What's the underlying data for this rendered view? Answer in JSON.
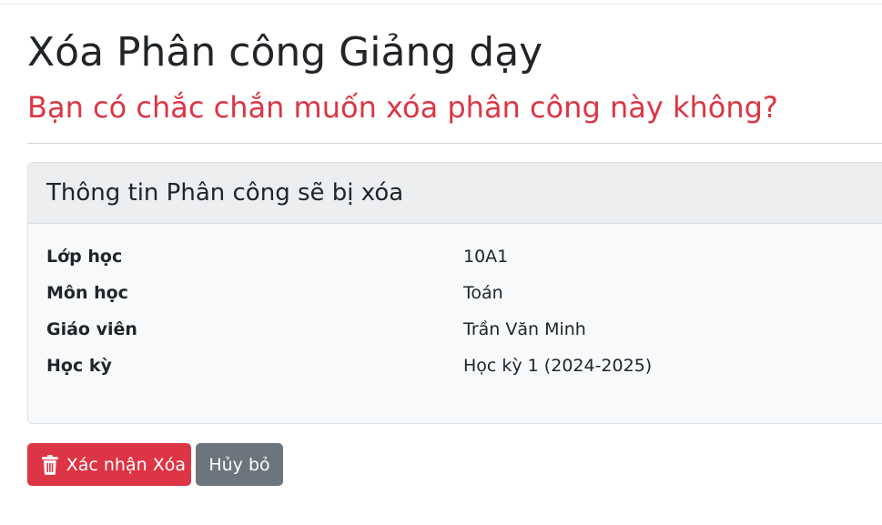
{
  "page": {
    "title": "Xóa Phân công Giảng dạy",
    "warning": "Bạn có chắc chắn muốn xóa phân công này không?"
  },
  "card": {
    "title": "Thông tin Phân công sẽ bị xóa",
    "rows": [
      {
        "label": "Lớp học",
        "value": "10A1"
      },
      {
        "label": "Môn học",
        "value": "Toán"
      },
      {
        "label": "Giáo viên",
        "value": "Trần Văn Minh"
      },
      {
        "label": "Học kỳ",
        "value": "Học kỳ 1 (2024-2025)"
      }
    ]
  },
  "actions": {
    "confirm_label": "Xác nhận Xóa",
    "confirm_icon": "trash-icon",
    "cancel_label": "Hủy bỏ"
  },
  "colors": {
    "danger": "#dc3545",
    "secondary": "#6c757d"
  }
}
